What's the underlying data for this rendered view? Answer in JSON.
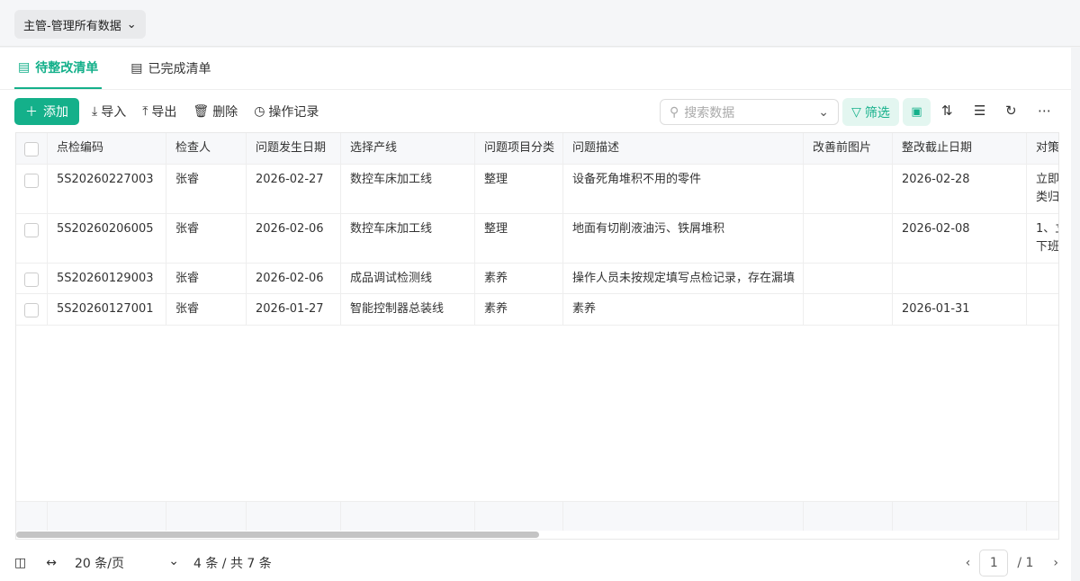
{
  "header": {
    "role_selector": "主管-管理所有数据"
  },
  "tabs": [
    {
      "label": "待整改清单",
      "active": true
    },
    {
      "label": "已完成清单",
      "active": false
    }
  ],
  "toolbar": {
    "add": "添加",
    "import": "导入",
    "export": "导出",
    "delete": "删除",
    "history": "操作记录",
    "search_placeholder": "搜索数据",
    "filter": "筛选"
  },
  "table": {
    "columns": [
      "点检编码",
      "检查人",
      "问题发生日期",
      "选择产线",
      "问题项目分类",
      "问题描述",
      "改善前图片",
      "整改截止日期",
      "对策"
    ],
    "rows": [
      [
        "5S20260227003",
        "张睿",
        "2026-02-27",
        "数控车床加工线",
        "整理",
        "设备死角堆积不用的零件",
        "",
        "2026-02-28",
        "立即\n类归"
      ],
      [
        "5S20260206005",
        "张睿",
        "2026-02-06",
        "数控车床加工线",
        "整理",
        "地面有切削液油污、铁屑堆积",
        "",
        "2026-02-08",
        "1、立\n下班"
      ],
      [
        "5S20260129003",
        "张睿",
        "2026-02-06",
        "成品调试检测线",
        "素养",
        "操作人员未按规定填写点检记录，存在漏填",
        "",
        "",
        ""
      ],
      [
        "5S20260127001",
        "张睿",
        "2026-01-27",
        "智能控制器总装线",
        "素养",
        "素养",
        "",
        "2026-01-31",
        ""
      ]
    ]
  },
  "footer": {
    "page_size": "20 条/页",
    "summary": "4 条 / 共 7 条",
    "current_page": "1",
    "total_pages": "/ 1"
  },
  "colors": {
    "accent": "#14b08a"
  }
}
